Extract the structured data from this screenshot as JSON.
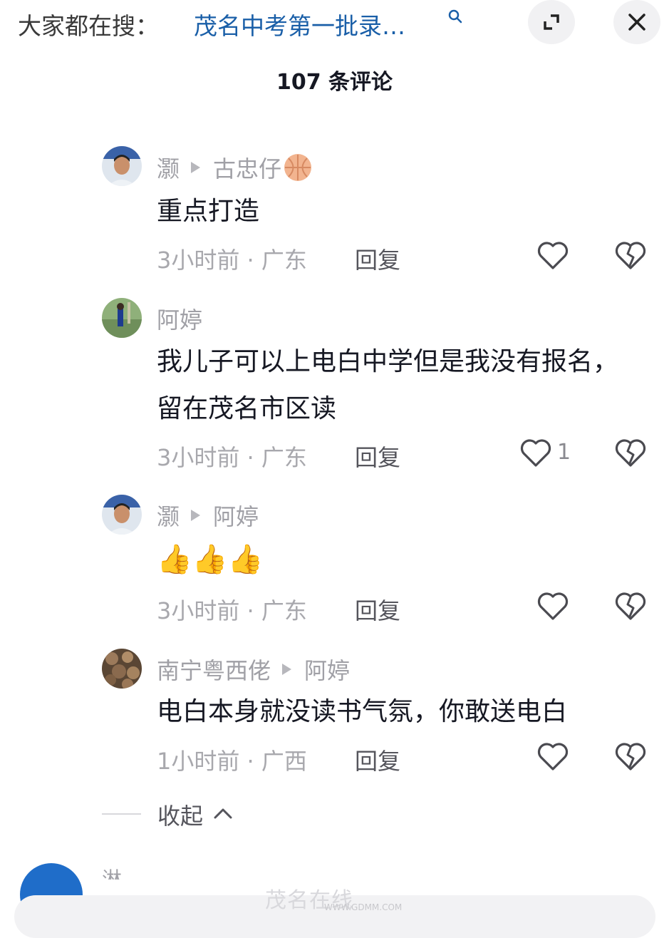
{
  "topbar": {
    "search_prefix": "大家都在搜：",
    "search_query": "茂名中考第一批录…"
  },
  "header": {
    "title": "107 条评论"
  },
  "comments": [
    {
      "author": "灏",
      "reply_to": "古忠仔",
      "text": "重点打造",
      "time": "3小时前 · 广东",
      "reply_label": "回复",
      "likes": ""
    },
    {
      "author": "阿婷",
      "reply_to": "",
      "text": "我儿子可以上电白中学但是我没有报名，留在茂名市区读",
      "time": "3小时前 · 广东",
      "reply_label": "回复",
      "likes": "1"
    },
    {
      "author": "灏",
      "reply_to": "阿婷",
      "text": "👍👍👍",
      "time": "3小时前 · 广东",
      "reply_label": "回复",
      "likes": ""
    },
    {
      "author": "南宁粤西佬",
      "reply_to": "阿婷",
      "text": "电白本身就没读书气氛，你敢送电白",
      "time": "1小时前 · 广西",
      "reply_label": "回复",
      "likes": ""
    }
  ],
  "collapse": {
    "label": "收起"
  },
  "next_comment": {
    "author_partial": "淋"
  },
  "watermark": {
    "main": "茂名在线",
    "sub": "WWW.GDMM.COM"
  },
  "icons": {
    "search": "search-icon",
    "expand": "expand-icon",
    "close": "close-icon",
    "like": "heart-icon",
    "dislike": "broken-heart-icon",
    "chevron": "chevron-up-icon"
  }
}
